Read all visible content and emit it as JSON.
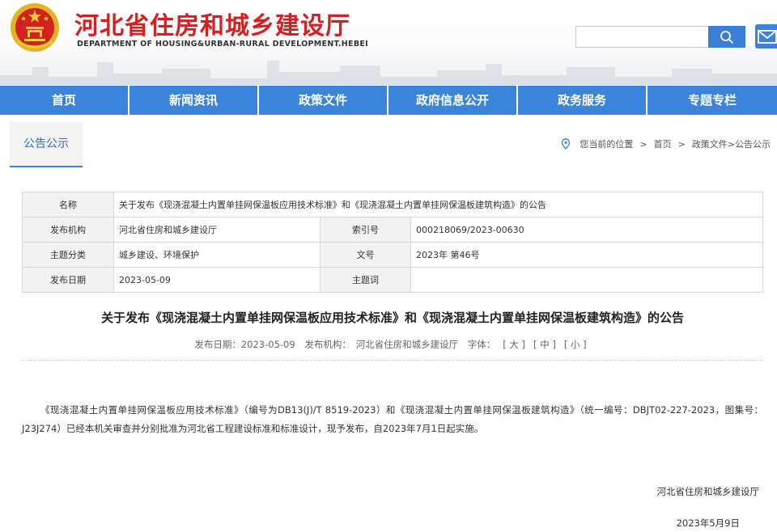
{
  "header": {
    "title": "河北省住房和城乡建设厅",
    "subtitle": "DEPARTMENT OF HOUSING&URBAN-RURAL DEVELOPMENT.HEBEI",
    "search_placeholder": "",
    "emblem_icon": "national-emblem-icon",
    "search_icon": "search-icon",
    "mail_icon": "mail-icon"
  },
  "nav": {
    "items": [
      {
        "label": "首页"
      },
      {
        "label": "新闻资讯"
      },
      {
        "label": "政策文件"
      },
      {
        "label": "政府信息公开"
      },
      {
        "label": "政务服务"
      },
      {
        "label": "专题专栏"
      }
    ]
  },
  "breadcrumb": {
    "tab": "公告公示",
    "location_label": "您当前的位置",
    "home": "首页",
    "path": "政策文件>公告公示",
    "pin_icon": "location-pin-icon"
  },
  "info": {
    "name_label": "名称",
    "name_value": "关于发布《现浇混凝土内置单挂网保温板应用技术标准》和《现浇混凝土内置单挂网保温板建筑构造》的公告",
    "org_label": "发布机构",
    "org_value": "河北省住房和城乡建设厅",
    "index_label": "索引号",
    "index_value": "000218069/2023-00630",
    "topic_label": "主题分类",
    "topic_value": "城乡建设、环境保护",
    "docno_label": "文号",
    "docno_value": "2023年 第46号",
    "date_label": "发布日期",
    "date_value": "2023-05-09",
    "keyword_label": "主题词",
    "keyword_value": ""
  },
  "article": {
    "title": "关于发布《现浇混凝土内置单挂网保温板应用技术标准》和《现浇混凝土内置单挂网保温板建筑构造》的公告",
    "meta_date": "发布日期：2023-05-09",
    "meta_org": "发布机构：　河北省住房和城乡建设厅",
    "meta_font": "字体：",
    "font_large": "[ 大 ]",
    "font_medium": "[ 中 ]",
    "font_small": "[ 小 ]",
    "body": "《现浇混凝土内置单挂网保温板应用技术标准》（编号为DB13(J)/T 8519-2023）和《现浇混凝土内置单挂网保温板建筑构造》（统一编号：DBJT02-227-2023，图集号：J23J274）已经本机关审查并分别批准为河北省工程建设标准和标准设计，现予发布，自2023年7月1日起实施。",
    "signature_org": "河北省住房和城乡建设厅",
    "signature_date": "2023年5月9日"
  },
  "colors": {
    "brand_red": "#d42020",
    "nav_blue": "#3a84dc",
    "link_blue": "#2a6ec3"
  }
}
